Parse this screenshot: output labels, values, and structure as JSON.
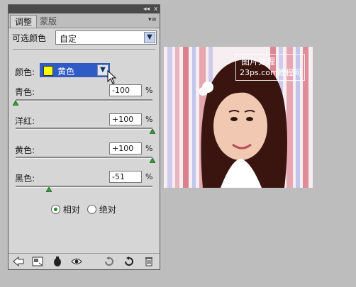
{
  "panel": {
    "tabs": [
      {
        "label": "调整"
      },
      {
        "label": "蒙版"
      }
    ],
    "title_controls": "◂◂",
    "close": "x",
    "menu_icon": "▾≡"
  },
  "preset": {
    "label": "可选颜色",
    "value": "自定"
  },
  "colors": {
    "label": "颜色:",
    "value": "黄色",
    "swatch": "#ffff00"
  },
  "sliders": [
    {
      "label": "青色:",
      "value": "-100",
      "unit": "%",
      "level": 0.0
    },
    {
      "label": "洋红:",
      "value": "+100",
      "unit": "%",
      "level": 1.0
    },
    {
      "label": "黄色:",
      "value": "+100",
      "unit": "%",
      "level": 1.0
    },
    {
      "label": "黑色:",
      "value": "-51",
      "unit": "%",
      "level": 0.245
    }
  ],
  "method": {
    "options": [
      {
        "label": "相对",
        "selected": true
      },
      {
        "label": "绝对",
        "selected": false
      }
    ]
  },
  "watermark": {
    "line1": "图片处理",
    "line2": "23ps.com教程网"
  },
  "accent": {
    "select_blue": "#2f5bc6",
    "thumb_green": "#3a9a3a"
  }
}
